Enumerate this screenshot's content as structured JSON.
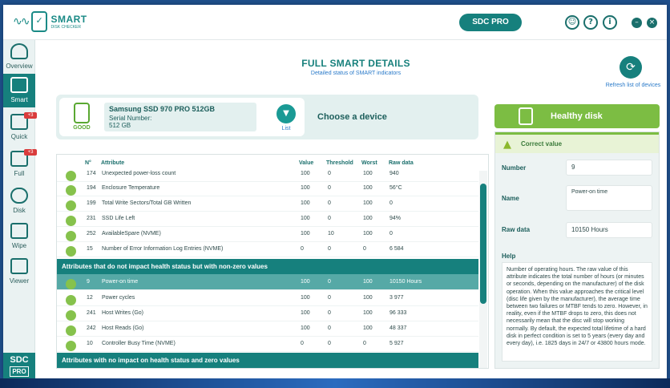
{
  "header": {
    "logo_title": "SMART",
    "logo_sub": "DISK CHECKER",
    "sdc_button": "SDC PRO",
    "help_glyph": "?",
    "info_glyph": "i",
    "minimize_glyph": "–",
    "close_glyph": "×"
  },
  "sidebar": {
    "items": [
      {
        "label": "Overview",
        "icon": "lightbulb-icon"
      },
      {
        "label": "Smart",
        "icon": "smart-disk-icon"
      },
      {
        "label": "Quick",
        "icon": "quick-icon",
        "badge": "+3"
      },
      {
        "label": "Full",
        "icon": "full-icon",
        "badge": "+3"
      },
      {
        "label": "Disk",
        "icon": "disk-numbers-icon"
      },
      {
        "label": "Wipe",
        "icon": "wipe-icon"
      },
      {
        "label": "Viewer",
        "icon": "viewer-icon"
      }
    ],
    "promo_top": "SDC",
    "promo_bottom": "PRO"
  },
  "main": {
    "title": "FULL SMART DETAILS",
    "subtitle": "Detailed status of SMART indicators",
    "refresh_label": "Refresh list of devices"
  },
  "device": {
    "status": "GOOD",
    "name": "Samsung SSD 970 PRO 512GB",
    "serial_label": "Serial Number:",
    "size": "512 GB",
    "list_label": "List",
    "choose_label": "Choose a device"
  },
  "table": {
    "headers": {
      "num": "N°",
      "attr": "Attribute",
      "value": "Value",
      "threshold": "Threshold",
      "worst": "Worst",
      "raw": "Raw data"
    },
    "group1": [
      {
        "num": "174",
        "attr": "Unexpected power-loss count",
        "value": "100",
        "threshold": "0",
        "worst": "100",
        "raw": "940"
      },
      {
        "num": "194",
        "attr": "Enclosure Temperature",
        "value": "100",
        "threshold": "0",
        "worst": "100",
        "raw": "56°C"
      },
      {
        "num": "199",
        "attr": "Total Write Sectors/Total GB Written",
        "value": "100",
        "threshold": "0",
        "worst": "100",
        "raw": "0"
      },
      {
        "num": "231",
        "attr": "SSD Life Left",
        "value": "100",
        "threshold": "0",
        "worst": "100",
        "raw": "94%"
      },
      {
        "num": "252",
        "attr": "AvailableSpare (NVME)",
        "value": "100",
        "threshold": "10",
        "worst": "100",
        "raw": "0"
      },
      {
        "num": "15",
        "attr": "Number of Error Information Log Entries (NVME)",
        "value": "0",
        "threshold": "0",
        "worst": "0",
        "raw": "6 584"
      }
    ],
    "section2": "Attributes that do not impact health status but with non-zero values",
    "group2": [
      {
        "num": "9",
        "attr": "Power-on time",
        "value": "100",
        "threshold": "0",
        "worst": "100",
        "raw": "10150 Hours"
      },
      {
        "num": "12",
        "attr": "Power cycles",
        "value": "100",
        "threshold": "0",
        "worst": "100",
        "raw": "3 977"
      },
      {
        "num": "241",
        "attr": "Host Writes (Go)",
        "value": "100",
        "threshold": "0",
        "worst": "100",
        "raw": "96 333"
      },
      {
        "num": "242",
        "attr": "Host Reads (Go)",
        "value": "100",
        "threshold": "0",
        "worst": "100",
        "raw": "48 337"
      },
      {
        "num": "10",
        "attr": "Controller Busy Time (NVME)",
        "value": "0",
        "threshold": "0",
        "worst": "0",
        "raw": "5 927"
      }
    ],
    "section3": "Attributes with no impact on health status and zero values"
  },
  "details": {
    "healthy_label": "Healthy disk",
    "correct_label": "Correct value",
    "number_label": "Number",
    "number_value": "9",
    "name_label": "Name",
    "name_value": "Power-on time",
    "raw_label": "Raw data",
    "raw_value": "10150 Hours",
    "help_label": "Help",
    "help_text": "Number of operating hours. The raw value of this attribute indicates the total number of hours (or minutes or seconds, depending on the manufacturer) of the disk operation. When this value approaches the critical level (disc life given by the manufacturer), the average time between two failures or MTBF tends to zero. However, in reality, even if the MTBF drops to zero, this does not necessarily mean that the disc will stop working normally. By default, the expected total lifetime of a hard disk in perfect condition is set to 5 years (every day and every day), i.e. 1825 days in 24/7 or 43800 hours mode."
  },
  "colors": {
    "accent": "#16807d",
    "healthy": "#7cbd43",
    "link": "#2a7ac9",
    "badge": "#d93c3c"
  }
}
